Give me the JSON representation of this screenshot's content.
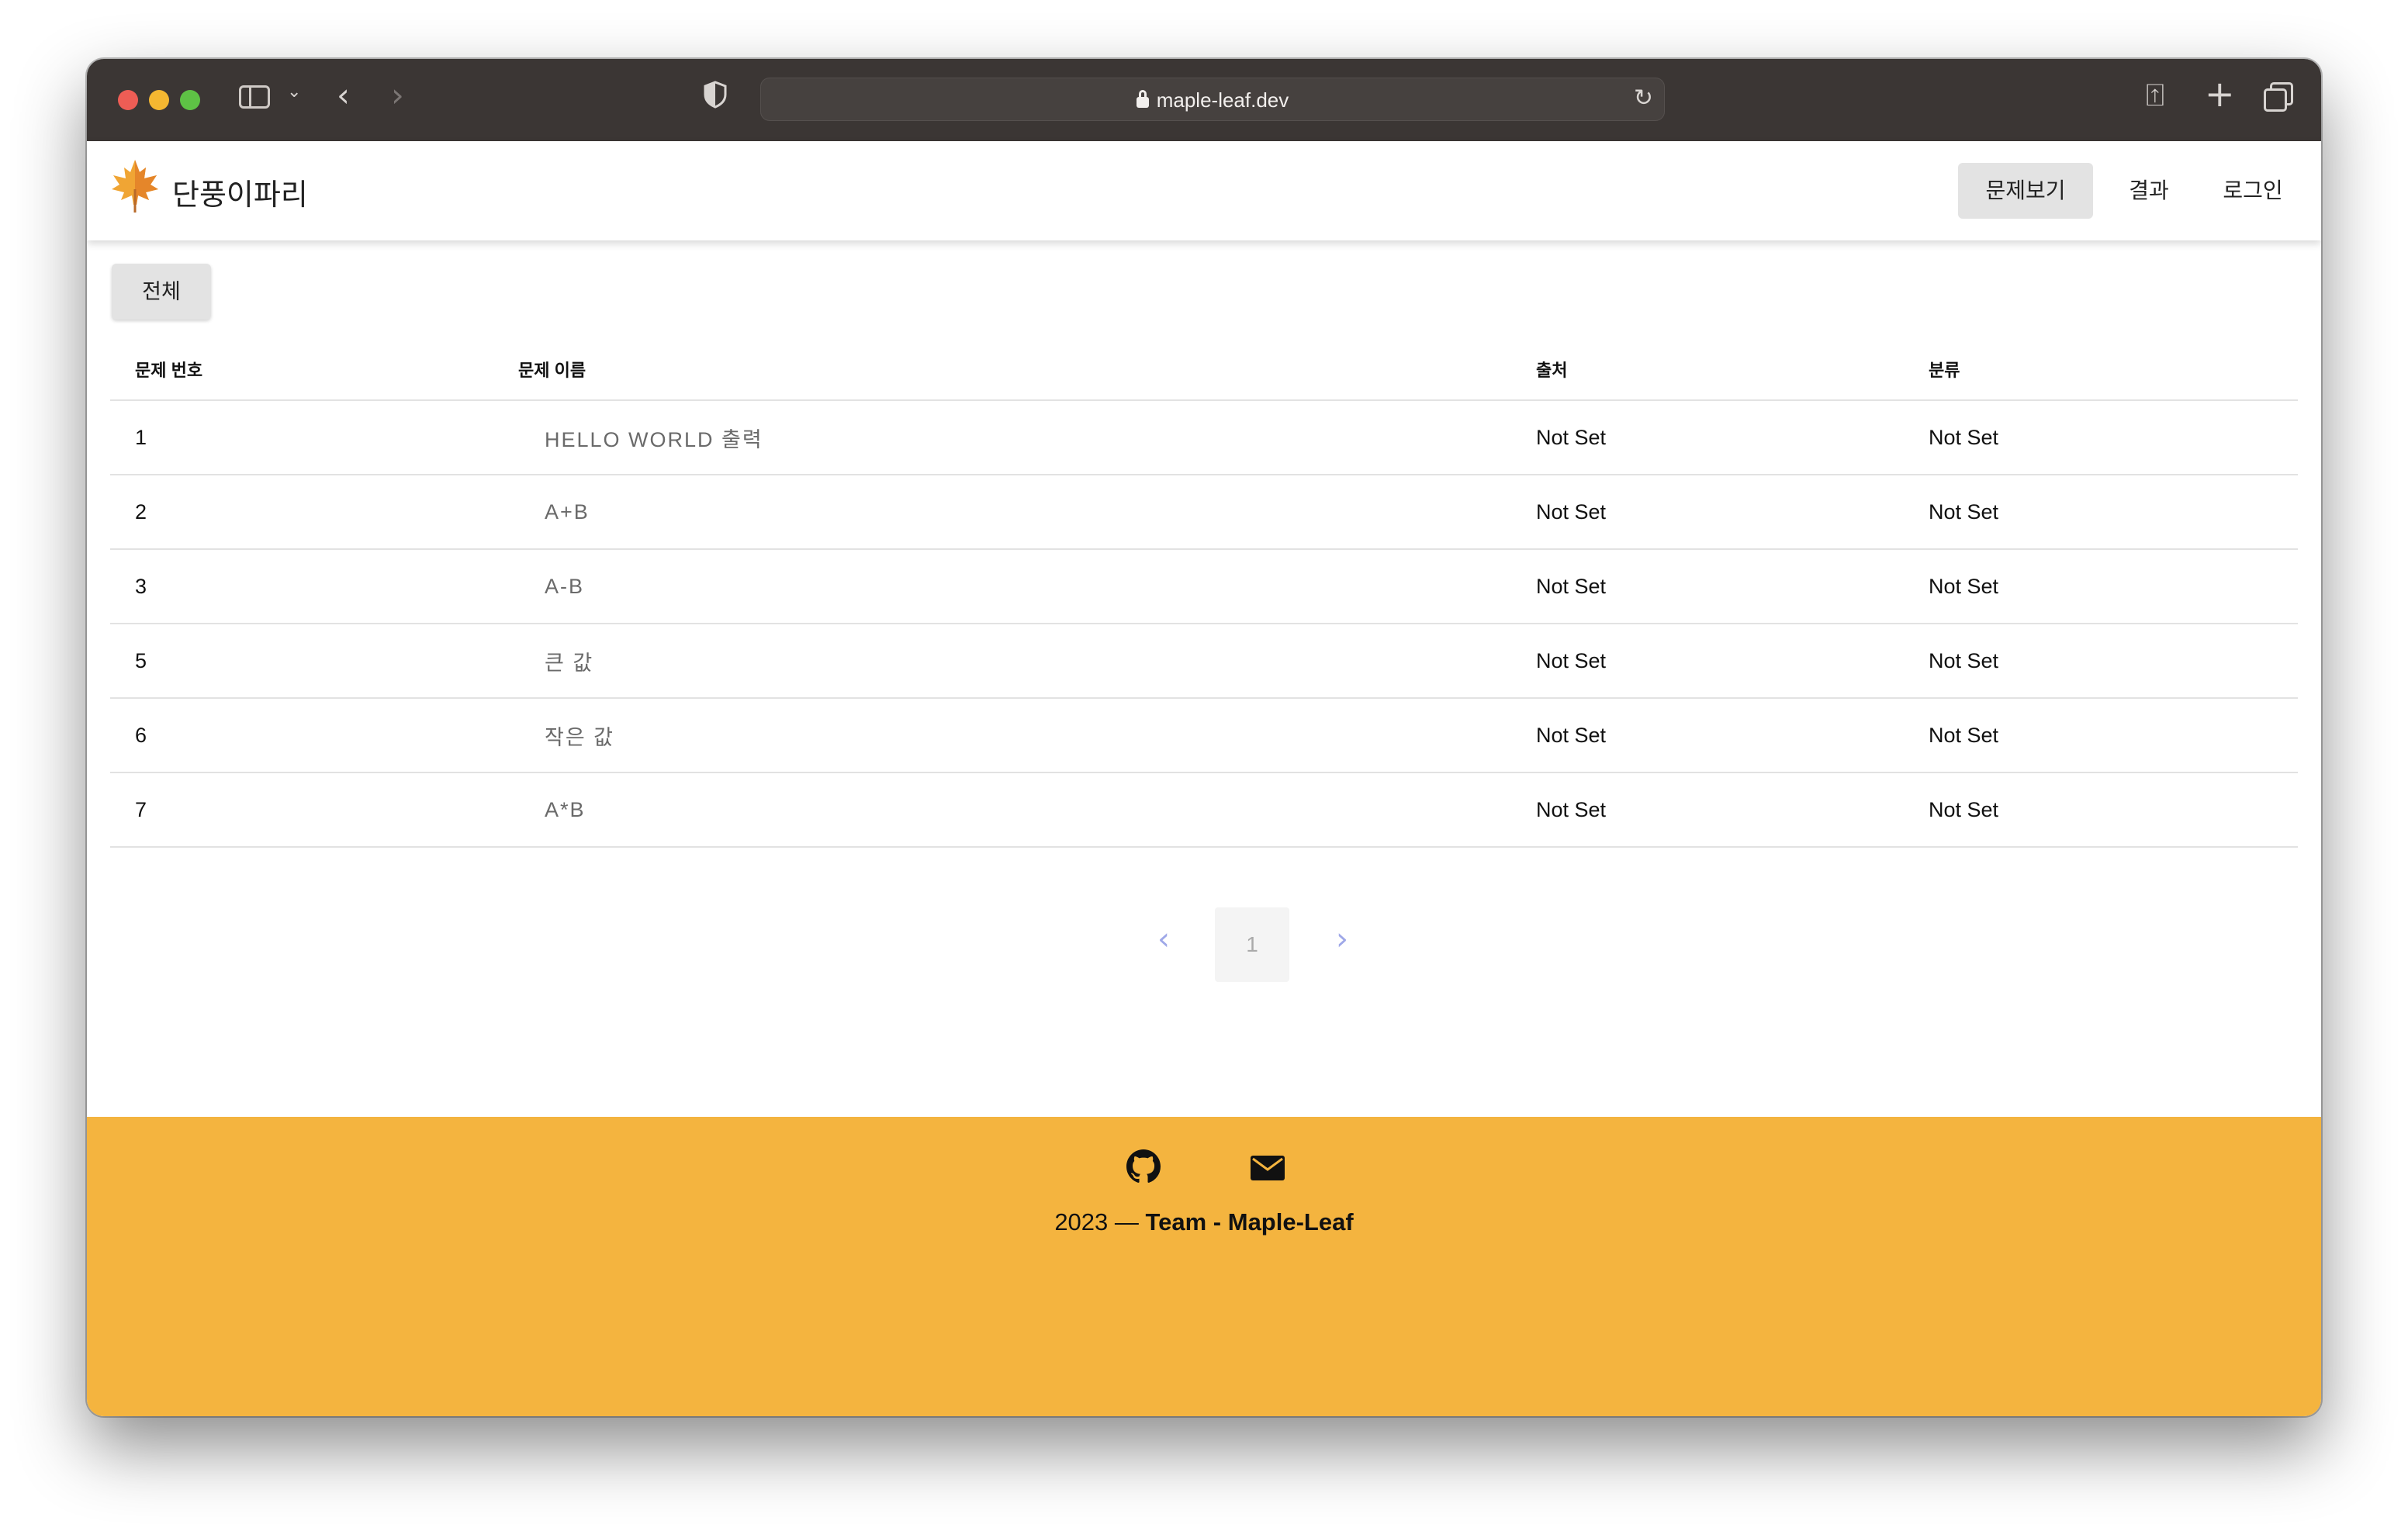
{
  "browser": {
    "url": "maple-leaf.dev"
  },
  "header": {
    "brand": "단풍이파리",
    "nav": [
      {
        "label": "문제보기",
        "active": true
      },
      {
        "label": "결과"
      },
      {
        "label": "로그인"
      }
    ]
  },
  "filter": {
    "label": "전체"
  },
  "table": {
    "columns": [
      "문제 번호",
      "문제 이름",
      "출처",
      "분류"
    ],
    "rows": [
      {
        "id": "1",
        "title": "HELLO WORLD 출력",
        "source": "Not Set",
        "category": "Not Set"
      },
      {
        "id": "2",
        "title": "A+B",
        "source": "Not Set",
        "category": "Not Set"
      },
      {
        "id": "3",
        "title": "A-B",
        "source": "Not Set",
        "category": "Not Set"
      },
      {
        "id": "5",
        "title": "큰 값",
        "source": "Not Set",
        "category": "Not Set"
      },
      {
        "id": "6",
        "title": "작은 값",
        "source": "Not Set",
        "category": "Not Set"
      },
      {
        "id": "7",
        "title": "A*B",
        "source": "Not Set",
        "category": "Not Set"
      }
    ]
  },
  "pagination": {
    "current": "1",
    "prev_icon": "chevron-left-icon",
    "next_icon": "chevron-right-icon"
  },
  "footer": {
    "year": "2023 — ",
    "team": "Team - Maple-Leaf",
    "icons": [
      "github-icon",
      "mail-icon"
    ],
    "background": "#f4b43f"
  },
  "colors": {
    "chrome": "#3b3634",
    "footer": "#f4b43f",
    "pager_accent": "#9fa8e8"
  }
}
